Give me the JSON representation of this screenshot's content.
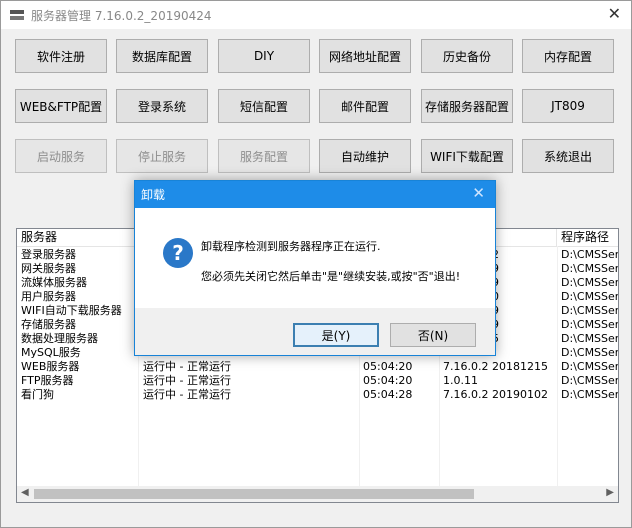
{
  "window": {
    "title": "服务器管理 7.16.0.2_20190424",
    "close_glyph": "✕"
  },
  "buttons": [
    {
      "label": "软件注册",
      "enabled": true
    },
    {
      "label": "数据库配置",
      "enabled": true
    },
    {
      "label": "DIY",
      "enabled": true
    },
    {
      "label": "网络地址配置",
      "enabled": true
    },
    {
      "label": "历史备份",
      "enabled": true
    },
    {
      "label": "内存配置",
      "enabled": true
    },
    {
      "label": "WEB&FTP配置",
      "enabled": true
    },
    {
      "label": "登录系统",
      "enabled": true
    },
    {
      "label": "短信配置",
      "enabled": true
    },
    {
      "label": "邮件配置",
      "enabled": true
    },
    {
      "label": "存储服务器配置",
      "enabled": true
    },
    {
      "label": "JT809",
      "enabled": true
    },
    {
      "label": "启动服务",
      "enabled": false
    },
    {
      "label": "停止服务",
      "enabled": false
    },
    {
      "label": "服务配置",
      "enabled": false
    },
    {
      "label": "自动维护",
      "enabled": true
    },
    {
      "label": "WIFI下载配置",
      "enabled": true
    },
    {
      "label": "系统退出",
      "enabled": true
    }
  ],
  "list": {
    "columns": [
      "服务器",
      "",
      "",
      "",
      "程序路径"
    ],
    "rows": [
      {
        "name": "登录服务器",
        "status": "",
        "time": "",
        "version": "20190102",
        "path": "D:\\CMSSer"
      },
      {
        "name": "网关服务器",
        "status": "",
        "time": "",
        "version": "20190329",
        "path": "D:\\CMSSer"
      },
      {
        "name": "流媒体服务器",
        "status": "",
        "time": "",
        "version": "20190329",
        "path": "D:\\CMSSer"
      },
      {
        "name": "用户服务器",
        "status": "",
        "time": "",
        "version": "20190510",
        "path": "D:\\CMSSer"
      },
      {
        "name": "WIFI自动下载服务器",
        "status": "",
        "time": "",
        "version": "20190329",
        "path": "D:\\CMSSer"
      },
      {
        "name": "存储服务器",
        "status": "",
        "time": "",
        "version": "20181229",
        "path": "D:\\CMSSer"
      },
      {
        "name": "数据处理服务器",
        "status": "",
        "time": "",
        "version": "20181215",
        "path": "D:\\CMSSer"
      },
      {
        "name": "MySQL服务",
        "status": "",
        "time": "",
        "version": "",
        "path": "D:\\CMSSer"
      },
      {
        "name": "WEB服务器",
        "status": "运行中 - 正常运行",
        "time": "05:04:20",
        "version": "7.16.0.2 20181215",
        "path": "D:\\CMSSer"
      },
      {
        "name": "FTP服务器",
        "status": "运行中 - 正常运行",
        "time": "05:04:20",
        "version": "1.0.11",
        "path": "D:\\CMSSer"
      },
      {
        "name": "看门狗",
        "status": "运行中 - 正常运行",
        "time": "05:04:28",
        "version": "7.16.0.2 20190102",
        "path": "D:\\CMSSer"
      }
    ]
  },
  "dialog": {
    "title": "卸载",
    "close_glyph": "✕",
    "icon": "question-icon",
    "icon_glyph": "?",
    "message_line1": "卸载程序检测到服务器程序正在运行.",
    "message_line2": "您必须先关闭它然后单击\"是\"继续安装,或按\"否\"退出!",
    "yes_label": "是(Y)",
    "no_label": "否(N)"
  }
}
